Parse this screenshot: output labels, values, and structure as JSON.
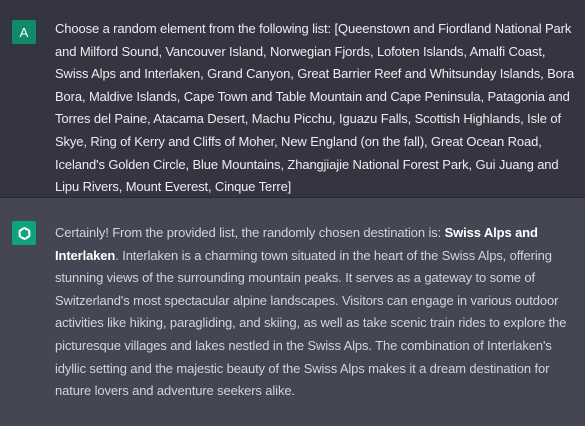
{
  "user": {
    "avatar_letter": "A",
    "message": "Choose a random element from the following list: [Queenstown and Fiordland National Park and Milford Sound, Vancouver Island, Norwegian Fjords, Lofoten Islands, Amalfi Coast, Swiss Alps and Interlaken, Grand Canyon, Great Barrier Reef and Whitsunday Islands, Bora Bora, Maldive Islands, Cape Town and Table Mountain and Cape Peninsula, Patagonia and Torres del Paine, Atacama Desert, Machu Picchu, Iguazu Falls, Scottish Highlands, Isle of Skye, Ring of Kerry and Cliffs of Moher, New England (on the fall), Great Ocean Road, Iceland's Golden Circle, Blue Mountains, Zhangjiajie National Forest Park, Gui Juang and Lipu Rivers, Mount Everest, Cinque Terre]"
  },
  "assistant": {
    "avatar_icon": "openai-logo-icon",
    "intro": "Certainly! From the provided list, the randomly chosen destination is: ",
    "highlight": "Swiss Alps and Interlaken",
    "body": ". Interlaken is a charming town situated in the heart of the Swiss Alps, offering stunning views of the surrounding mountain peaks. It serves as a gateway to some of Switzerland's most spectacular alpine landscapes. Visitors can engage in various outdoor activities like hiking, paragliding, and skiing, as well as take scenic train rides to explore the picturesque villages and lakes nestled in the Swiss Alps. The combination of Interlaken's idyllic setting and the majestic beauty of the Swiss Alps makes it a dream destination for nature lovers and adventure seekers alike."
  },
  "colors": {
    "user_bg": "#343541",
    "assistant_bg": "#444654",
    "user_avatar": "#0f8a6a",
    "assistant_avatar": "#10a37f",
    "text": "#d1d5db"
  }
}
